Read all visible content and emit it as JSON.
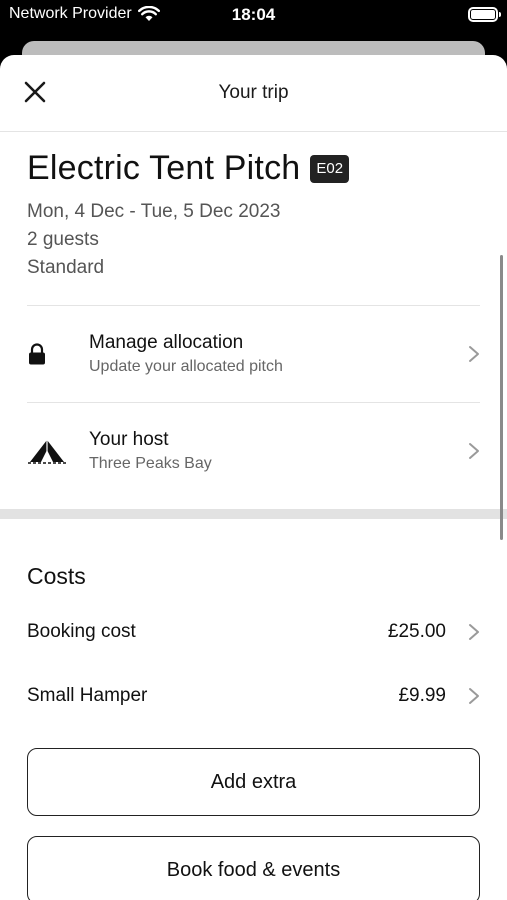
{
  "status_bar": {
    "carrier": "Network Provider",
    "time": "18:04"
  },
  "header": {
    "title": "Your trip",
    "close_icon": "close-icon"
  },
  "pitch": {
    "name": "Electric Tent Pitch",
    "code": "E02",
    "dates": "Mon, 4 Dec - Tue, 5 Dec 2023",
    "guests": "2 guests",
    "rate": "Standard"
  },
  "rows": [
    {
      "title": "Manage allocation",
      "subtitle": "Update your allocated pitch",
      "icon": "lock-icon"
    },
    {
      "title": "Your host",
      "subtitle": "Three Peaks Bay",
      "icon": "tent-icon"
    }
  ],
  "costs": {
    "heading": "Costs",
    "items": [
      {
        "label": "Booking cost",
        "value": "£25.00"
      },
      {
        "label": "Small Hamper",
        "value": "£9.99"
      }
    ]
  },
  "buttons": {
    "add_extra": "Add extra",
    "book_food": "Book food & events"
  },
  "colors": {
    "badge_bg": "#222222",
    "divider": "#e4e4e4",
    "section_gap": "#e2e2e2"
  }
}
